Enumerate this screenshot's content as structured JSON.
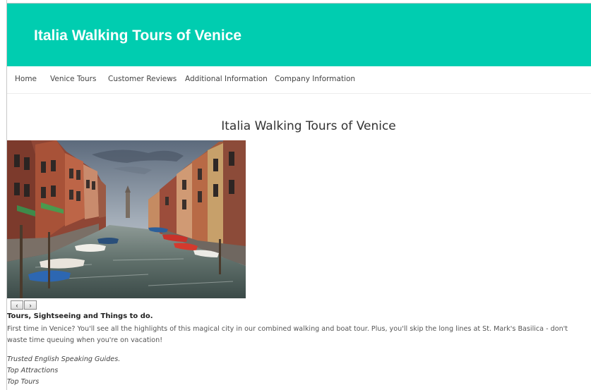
{
  "site": {
    "title": "Italia Walking Tours of Venice"
  },
  "nav": {
    "items": [
      {
        "label": "Home"
      },
      {
        "label": "Venice Tours"
      },
      {
        "label": "Customer Reviews"
      },
      {
        "label": "Additional Information"
      },
      {
        "label": "Company Information"
      }
    ]
  },
  "main": {
    "heading": "Italia Walking Tours of Venice",
    "hero": {
      "subject": "Venice canal with moored boats and colorful buildings"
    },
    "slider": {
      "prev_label": "‹",
      "next_label": "›"
    },
    "section_title": "Tours, Sightseeing and Things to do.",
    "intro": "First time in Venice? You'll see all the highlights of this magical city in our combined walking and boat tour. Plus, you'll skip the long lines at St. Mark's Basilica - don't waste time queuing when you're on vacation!",
    "features": [
      "Trusted English Speaking Guides.",
      "Top Attractions",
      "Top Tours"
    ]
  },
  "colors": {
    "banner": "#00cdb0",
    "title_text": "#ffffff",
    "nav_text": "#444444"
  }
}
